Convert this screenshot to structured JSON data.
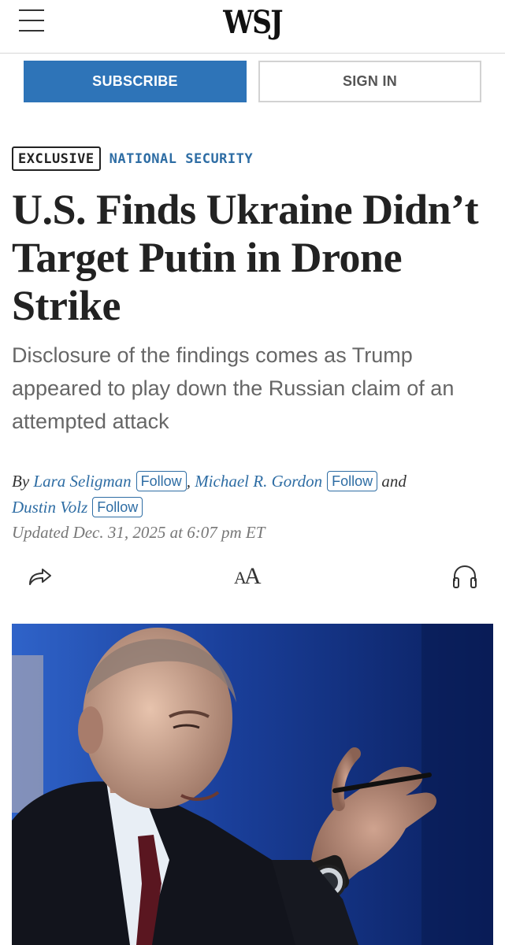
{
  "header": {
    "logo": "WSJ",
    "menu_icon": "hamburger-menu-icon"
  },
  "actions": {
    "subscribe_label": "SUBSCRIBE",
    "signin_label": "SIGN IN"
  },
  "article": {
    "flag": "EXCLUSIVE",
    "section": "NATIONAL SECURITY",
    "headline": "U.S. Finds Ukraine Didn’t Target Putin in Drone Strike",
    "dek": "Disclosure of the findings comes as Trump appeared to play down the Russian claim of an attempted attack",
    "byline": {
      "prefix": "By",
      "authors": [
        {
          "name": "Lara Seligman",
          "follow": "Follow"
        },
        {
          "name": "Michael R. Gordon",
          "follow": "Follow"
        },
        {
          "name": "Dustin Volz",
          "follow": "Follow"
        }
      ],
      "separator": ",",
      "conjunction": "and"
    },
    "timestamp": "Updated Dec. 31, 2025 at 6:07 pm ET"
  },
  "tools": {
    "share_icon": "share-icon",
    "text_size_glyph": "A",
    "text_size_glyph_small": "A",
    "audio_icon": "headphones-icon"
  },
  "colors": {
    "accent": "#2e74b8",
    "link": "#2e6da4",
    "headline": "#222222",
    "dek": "#666666",
    "photo_background": "#0d2a73"
  }
}
